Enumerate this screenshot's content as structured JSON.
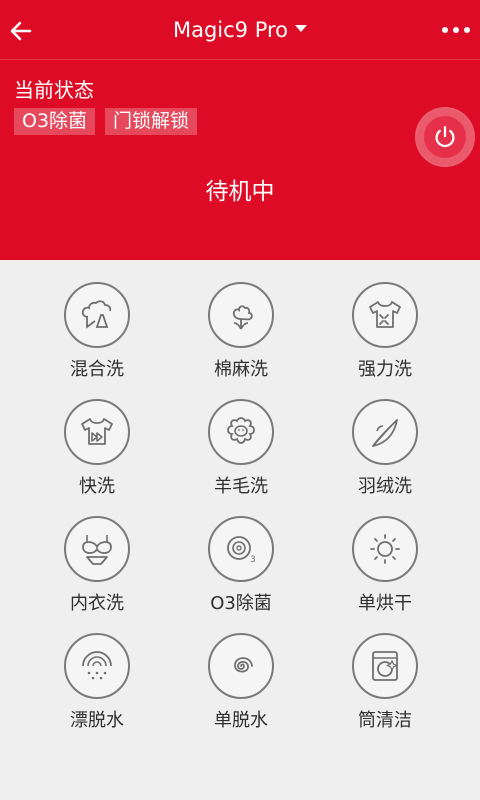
{
  "header": {
    "device_title": "Magic9 Pro",
    "status_label": "当前状态",
    "tags": [
      "O3除菌",
      "门锁解锁"
    ],
    "state_text": "待机中",
    "bg_color": "#de0b26"
  },
  "modes": [
    {
      "label": "混合洗",
      "icon": "mixed-wash-icon"
    },
    {
      "label": "棉麻洗",
      "icon": "cotton-icon"
    },
    {
      "label": "强力洗",
      "icon": "heavy-duty-icon"
    },
    {
      "label": "快洗",
      "icon": "quick-wash-icon"
    },
    {
      "label": "羊毛洗",
      "icon": "wool-icon"
    },
    {
      "label": "羽绒洗",
      "icon": "down-feather-icon"
    },
    {
      "label": "内衣洗",
      "icon": "underwear-icon"
    },
    {
      "label": "O3除菌",
      "icon": "ozone-sterilize-icon"
    },
    {
      "label": "单烘干",
      "icon": "dry-only-icon"
    },
    {
      "label": "漂脱水",
      "icon": "rinse-spin-icon"
    },
    {
      "label": "单脱水",
      "icon": "spin-only-icon"
    },
    {
      "label": "筒清洁",
      "icon": "drum-clean-icon"
    }
  ]
}
